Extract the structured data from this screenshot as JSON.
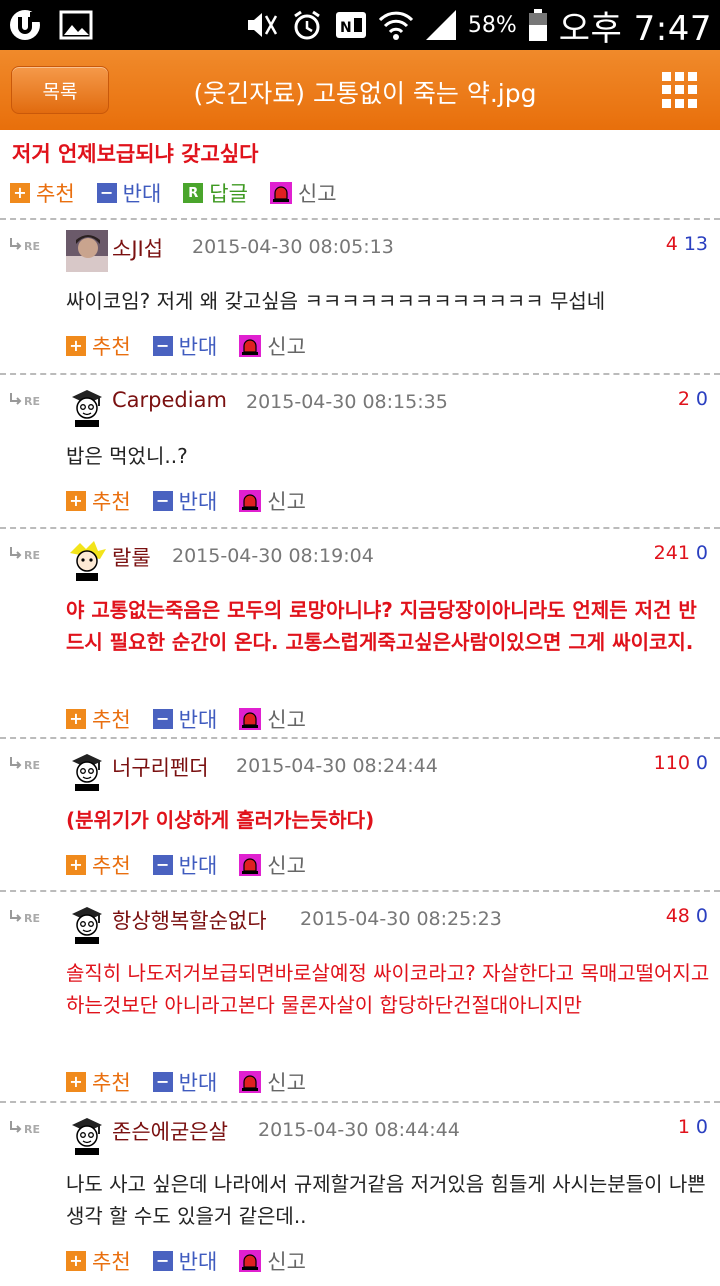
{
  "status_bar": {
    "battery_percent": "58%",
    "time": "오후 7:47",
    "icons": [
      "app-icon",
      "image-icon",
      "mute-icon",
      "alarm-icon",
      "nfc-icon",
      "wifi-icon",
      "signal-icon",
      "battery-icon"
    ]
  },
  "header": {
    "list_button": "목록",
    "title": "(웃긴자료) 고통없이 죽는 약.jpg",
    "menu_icon": "grid-icon"
  },
  "post": {
    "body": "저거 언제보급되냐 갖고싶다",
    "actions": {
      "recommend": "추천",
      "oppose": "반대",
      "reply": "답글",
      "report": "신고"
    }
  },
  "colors": {
    "accent": "#e87410",
    "red_text": "#e0121b",
    "blue_count": "#2a3fc0"
  },
  "comments": [
    {
      "name": "소JI섭",
      "date": "2015-04-30 08:05:13",
      "up": "4",
      "down": "13",
      "text": "싸이코임? 저게 왜 갖고싶음 ㅋㅋㅋㅋㅋㅋㅋㅋㅋㅋㅋㅋㅋ 무섭네",
      "style": "normal",
      "recommend": "추천",
      "oppose": "반대",
      "report": "신고"
    },
    {
      "name": "Carpediam",
      "date": "2015-04-30 08:15:35",
      "up": "2",
      "down": "0",
      "text": "밥은 먹었니..?",
      "style": "normal",
      "recommend": "추천",
      "oppose": "반대",
      "report": "신고"
    },
    {
      "name": "랄룰",
      "date": "2015-04-30 08:19:04",
      "up": "241",
      "down": "0",
      "text": "야 고통없는죽음은 모두의 로망아니냐? 지금당장이아니라도 언제든 저건 반드시 필요한 순간이 온다. 고통스럽게죽고싶은사람이있으면 그게 싸이코지.",
      "style": "red-bold",
      "recommend": "추천",
      "oppose": "반대",
      "report": "신고"
    },
    {
      "name": "너구리펜더",
      "date": "2015-04-30 08:24:44",
      "up": "110",
      "down": "0",
      "text": "(분위기가 이상하게 흘러가는듯하다)",
      "style": "red-bold",
      "recommend": "추천",
      "oppose": "반대",
      "report": "신고"
    },
    {
      "name": "항상행복할순없다",
      "date": "2015-04-30 08:25:23",
      "up": "48",
      "down": "0",
      "text": "솔직히 나도저거보급되면바로살예정 싸이코라고? 자살한다고 목매고떨어지고하는것보단 아니라고본다 물론자살이 합당하단건절대아니지만",
      "style": "red",
      "recommend": "추천",
      "oppose": "반대",
      "report": "신고"
    },
    {
      "name": "존슨에굳은살",
      "date": "2015-04-30 08:44:44",
      "up": "1",
      "down": "0",
      "text": "나도 사고 싶은데 나라에서 규제할거같음 저거있음 힘들게 사시는분들이 나쁜생각 할 수도 있을거 같은데..",
      "style": "normal",
      "recommend": "추천",
      "oppose": "반대",
      "report": "신고"
    }
  ]
}
